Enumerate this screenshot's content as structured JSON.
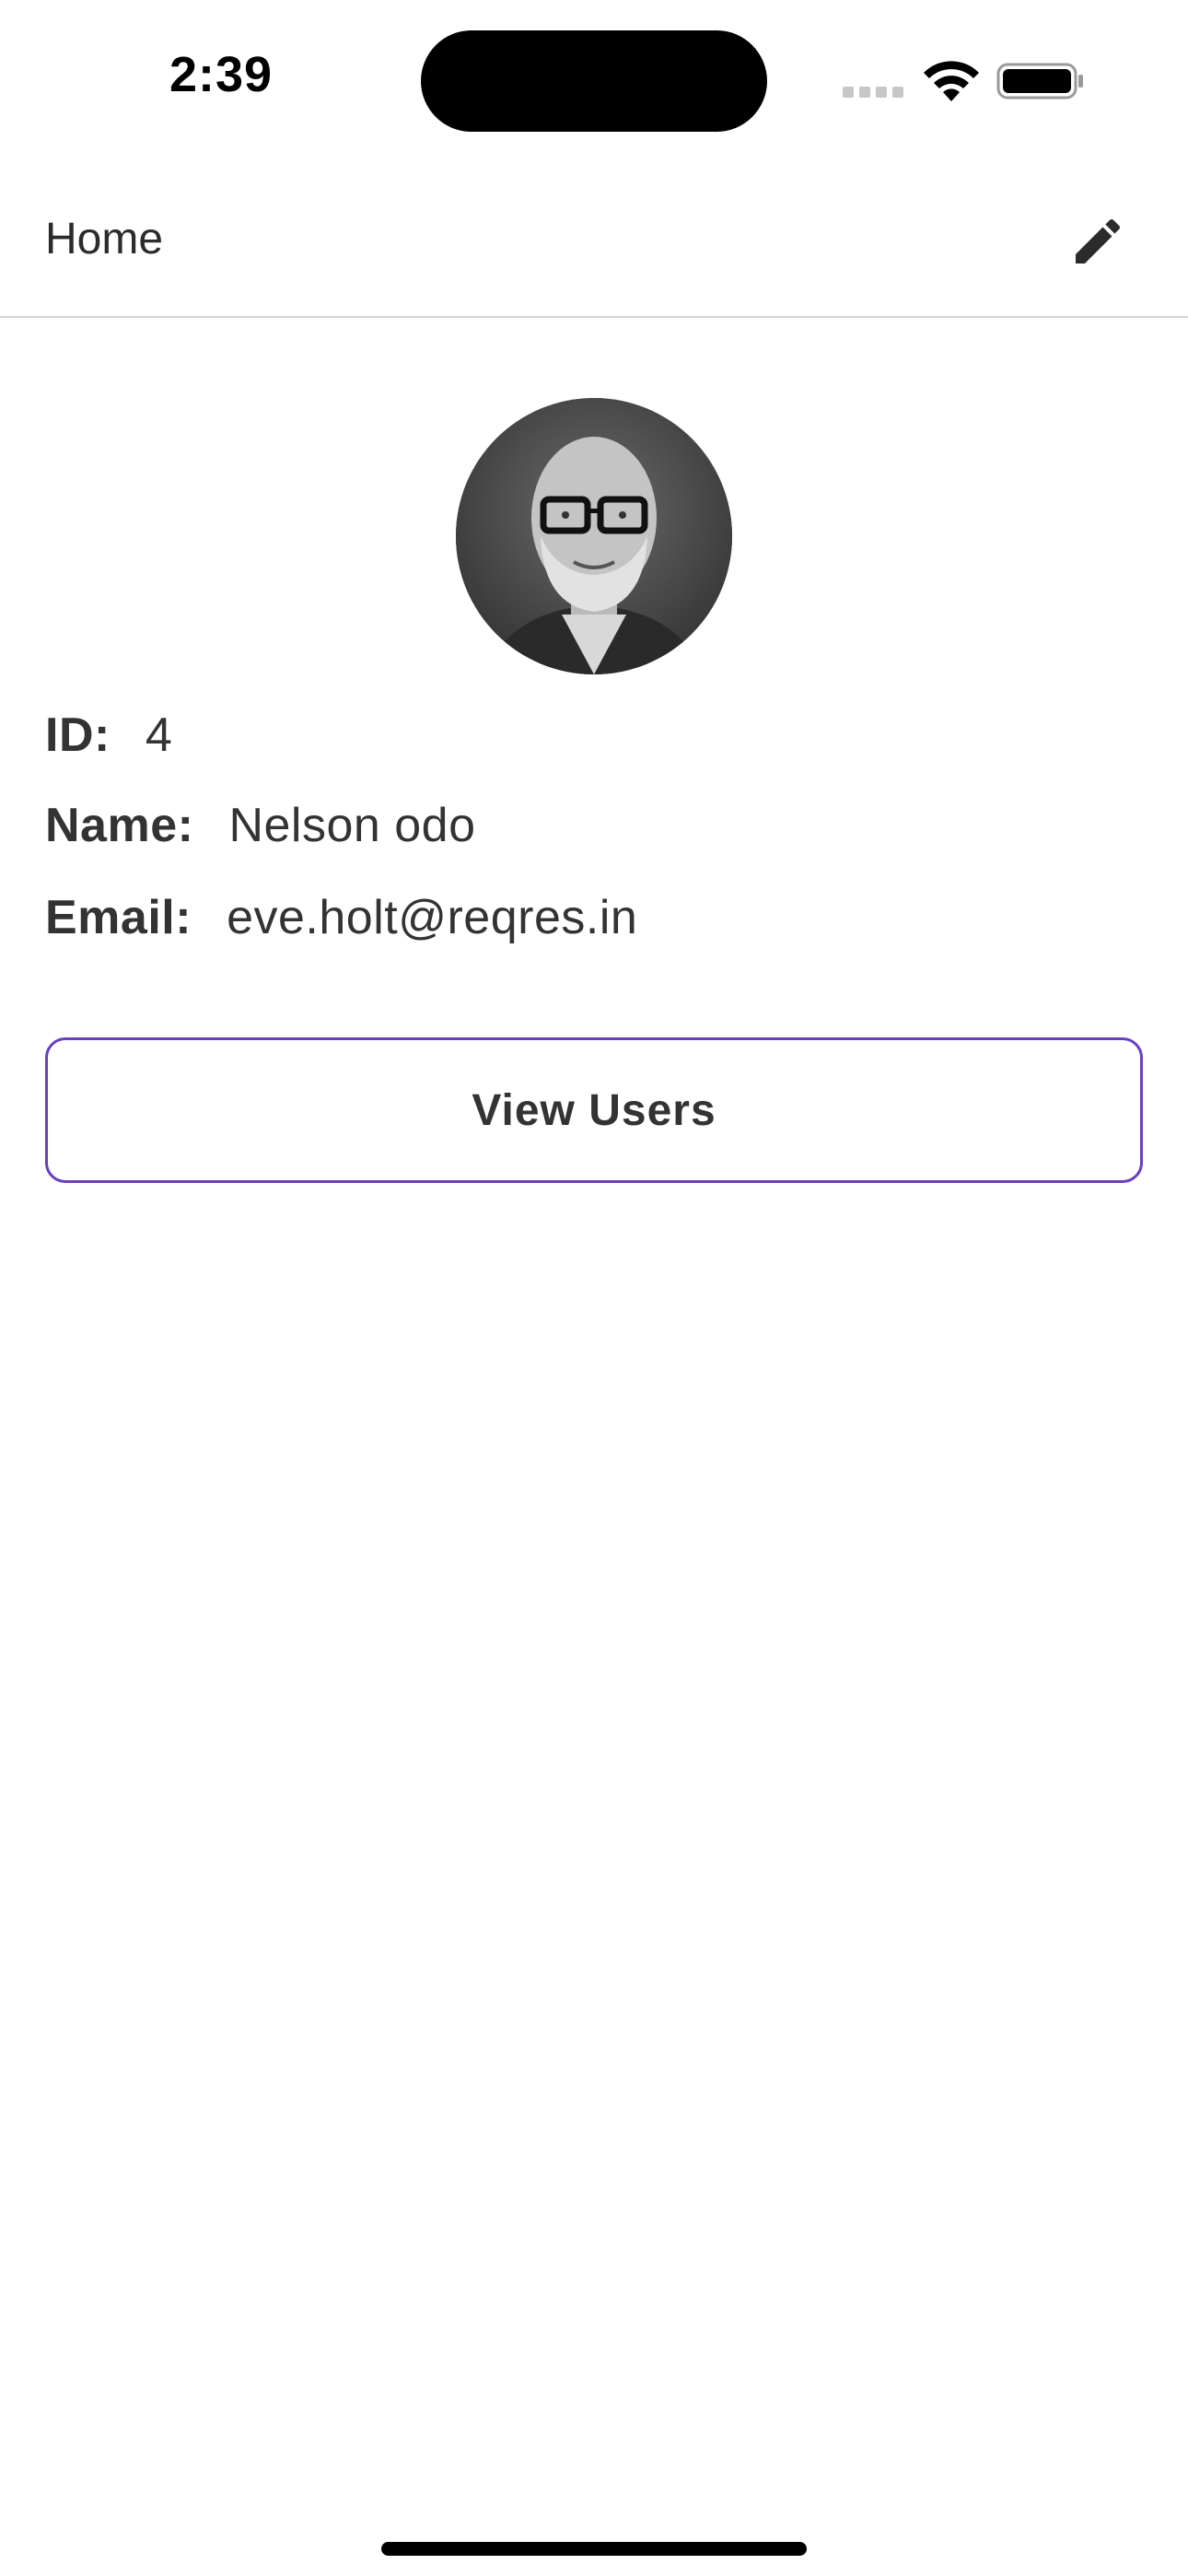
{
  "status_bar": {
    "time": "2:39",
    "icons": [
      "signal-icon",
      "wifi-icon",
      "battery-icon"
    ]
  },
  "app_bar": {
    "title": "Home",
    "action_icon": "edit-icon"
  },
  "profile": {
    "avatar": "user-avatar",
    "id_label": "ID:",
    "id_value": "4",
    "name_label": "Name:",
    "name_value": "Nelson odo",
    "email_label": "Email:",
    "email_value": "eve.holt@reqres.in"
  },
  "actions": {
    "view_users_label": "View Users"
  },
  "colors": {
    "button_border": "#6a3fc4",
    "divider": "#d6d6d6",
    "text": "#333333"
  }
}
